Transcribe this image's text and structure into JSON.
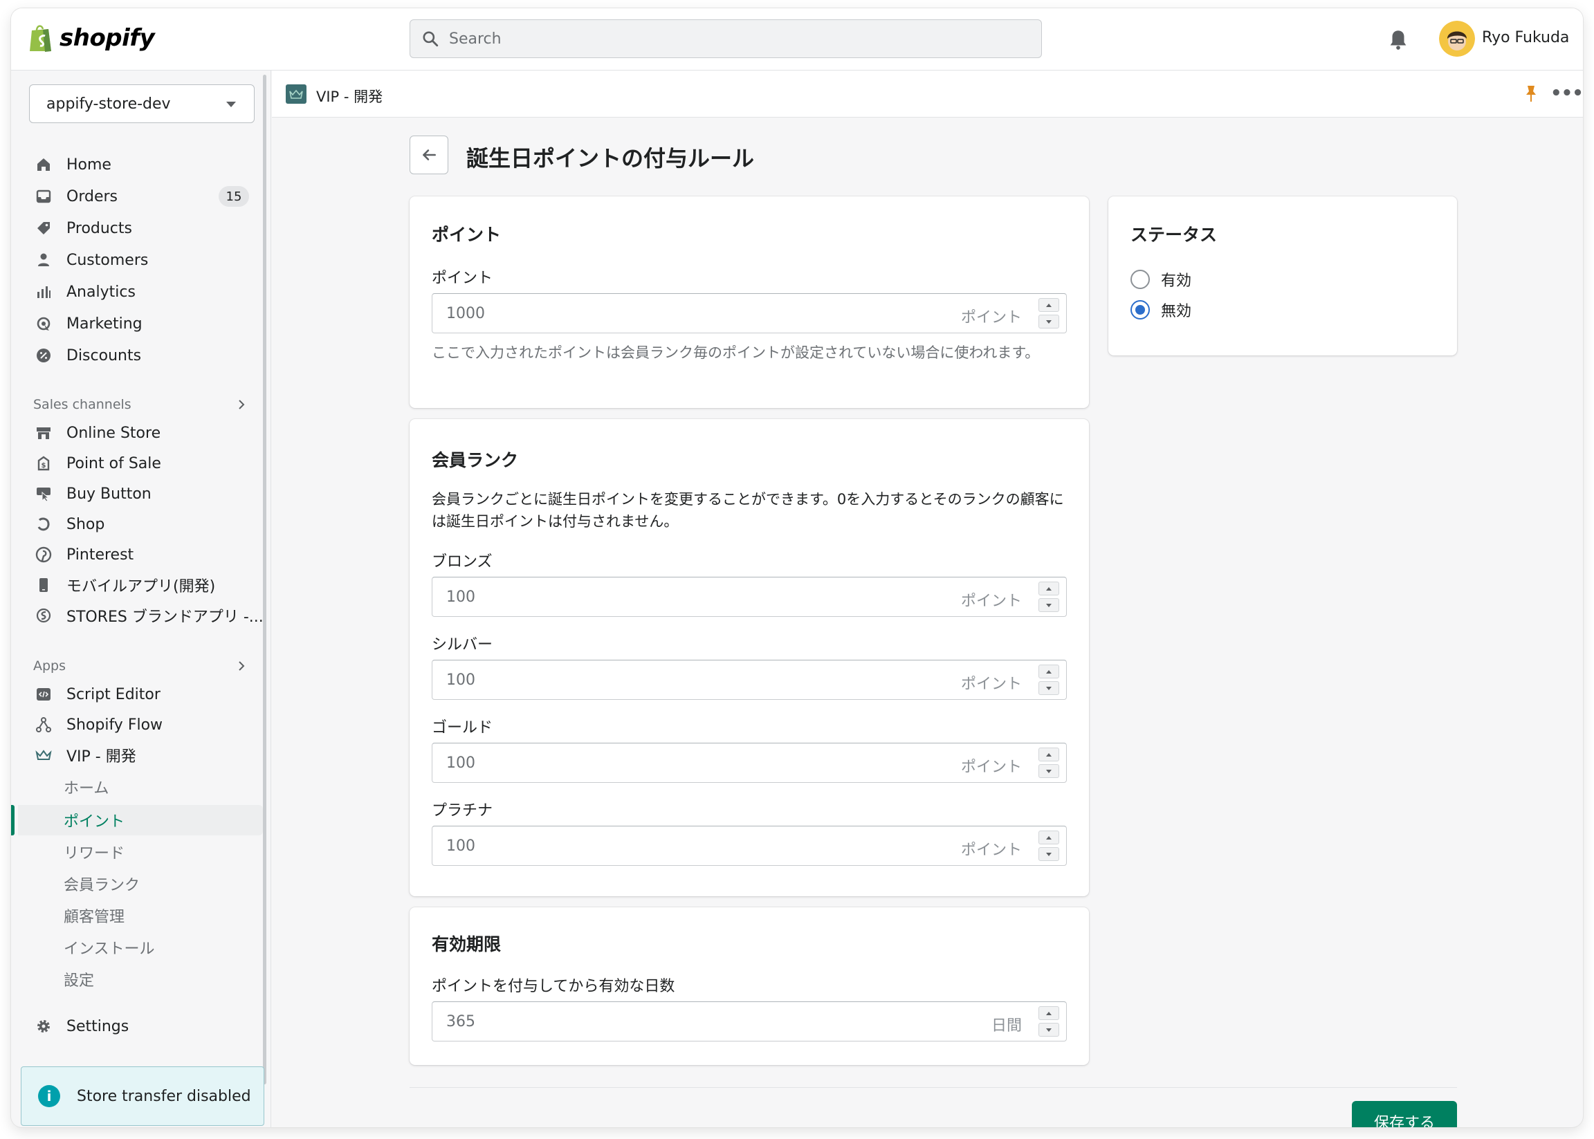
{
  "topbar": {
    "logo_text": "shopify",
    "search_placeholder": "Search",
    "user_name": "Ryo Fukuda"
  },
  "sidebar": {
    "store": "appify-store-dev",
    "main_nav": [
      {
        "label": "Home",
        "icon": "home-icon"
      },
      {
        "label": "Orders",
        "icon": "orders-icon",
        "badge": "15"
      },
      {
        "label": "Products",
        "icon": "tag-icon"
      },
      {
        "label": "Customers",
        "icon": "person-icon"
      },
      {
        "label": "Analytics",
        "icon": "bar-chart-icon"
      },
      {
        "label": "Marketing",
        "icon": "marketing-icon"
      },
      {
        "label": "Discounts",
        "icon": "discount-icon"
      }
    ],
    "sales_channels_heading": "Sales channels",
    "sales_channels": [
      {
        "label": "Online Store",
        "icon": "store-icon"
      },
      {
        "label": "Point of Sale",
        "icon": "pos-icon"
      },
      {
        "label": "Buy Button",
        "icon": "buy-button-icon"
      },
      {
        "label": "Shop",
        "icon": "shop-icon"
      },
      {
        "label": "Pinterest",
        "icon": "pinterest-icon"
      },
      {
        "label": "モバイルアプリ(開発)",
        "icon": "mobile-icon"
      },
      {
        "label": "STORES ブランドアプリ -...",
        "icon": "stores-icon"
      }
    ],
    "apps_heading": "Apps",
    "apps": [
      {
        "label": "Script Editor",
        "icon": "code-icon"
      },
      {
        "label": "Shopify Flow",
        "icon": "flow-icon"
      },
      {
        "label": "VIP - 開発",
        "icon": "crown-icon"
      }
    ],
    "vip_subitems": [
      "ホーム",
      "ポイント",
      "リワード",
      "会員ランク",
      "顧客管理",
      "インストール",
      "設定"
    ],
    "active_subitem": "ポイント",
    "settings_label": "Settings",
    "transfer_notice": "Store transfer disabled"
  },
  "app_header": {
    "name": "VIP - 開発"
  },
  "page": {
    "title": "誕生日ポイントの付与ルール",
    "points_card": {
      "title": "ポイント",
      "label": "ポイント",
      "value": "1000",
      "suffix": "ポイント",
      "help": "ここで入力されたポイントは会員ランク毎のポイントが設定されていない場合に使われます。"
    },
    "rank_card": {
      "title": "会員ランク",
      "description": "会員ランクごとに誕生日ポイントを変更することができます。0を入力するとそのランクの顧客には誕生日ポイントは付与されません。",
      "ranks": [
        {
          "label": "ブロンズ",
          "value": "100",
          "suffix": "ポイント"
        },
        {
          "label": "シルバー",
          "value": "100",
          "suffix": "ポイント"
        },
        {
          "label": "ゴールド",
          "value": "100",
          "suffix": "ポイント"
        },
        {
          "label": "プラチナ",
          "value": "100",
          "suffix": "ポイント"
        }
      ]
    },
    "expiry_card": {
      "title": "有効期限",
      "label": "ポイントを付与してから有効な日数",
      "value": "365",
      "suffix": "日間"
    },
    "status_card": {
      "title": "ステータス",
      "options": [
        "有効",
        "無効"
      ],
      "selected": "無効"
    },
    "save_label": "保存する"
  },
  "colors": {
    "accent_green": "#008060",
    "radio_blue": "#2c6ecb",
    "info_teal": "#00a0ac"
  }
}
